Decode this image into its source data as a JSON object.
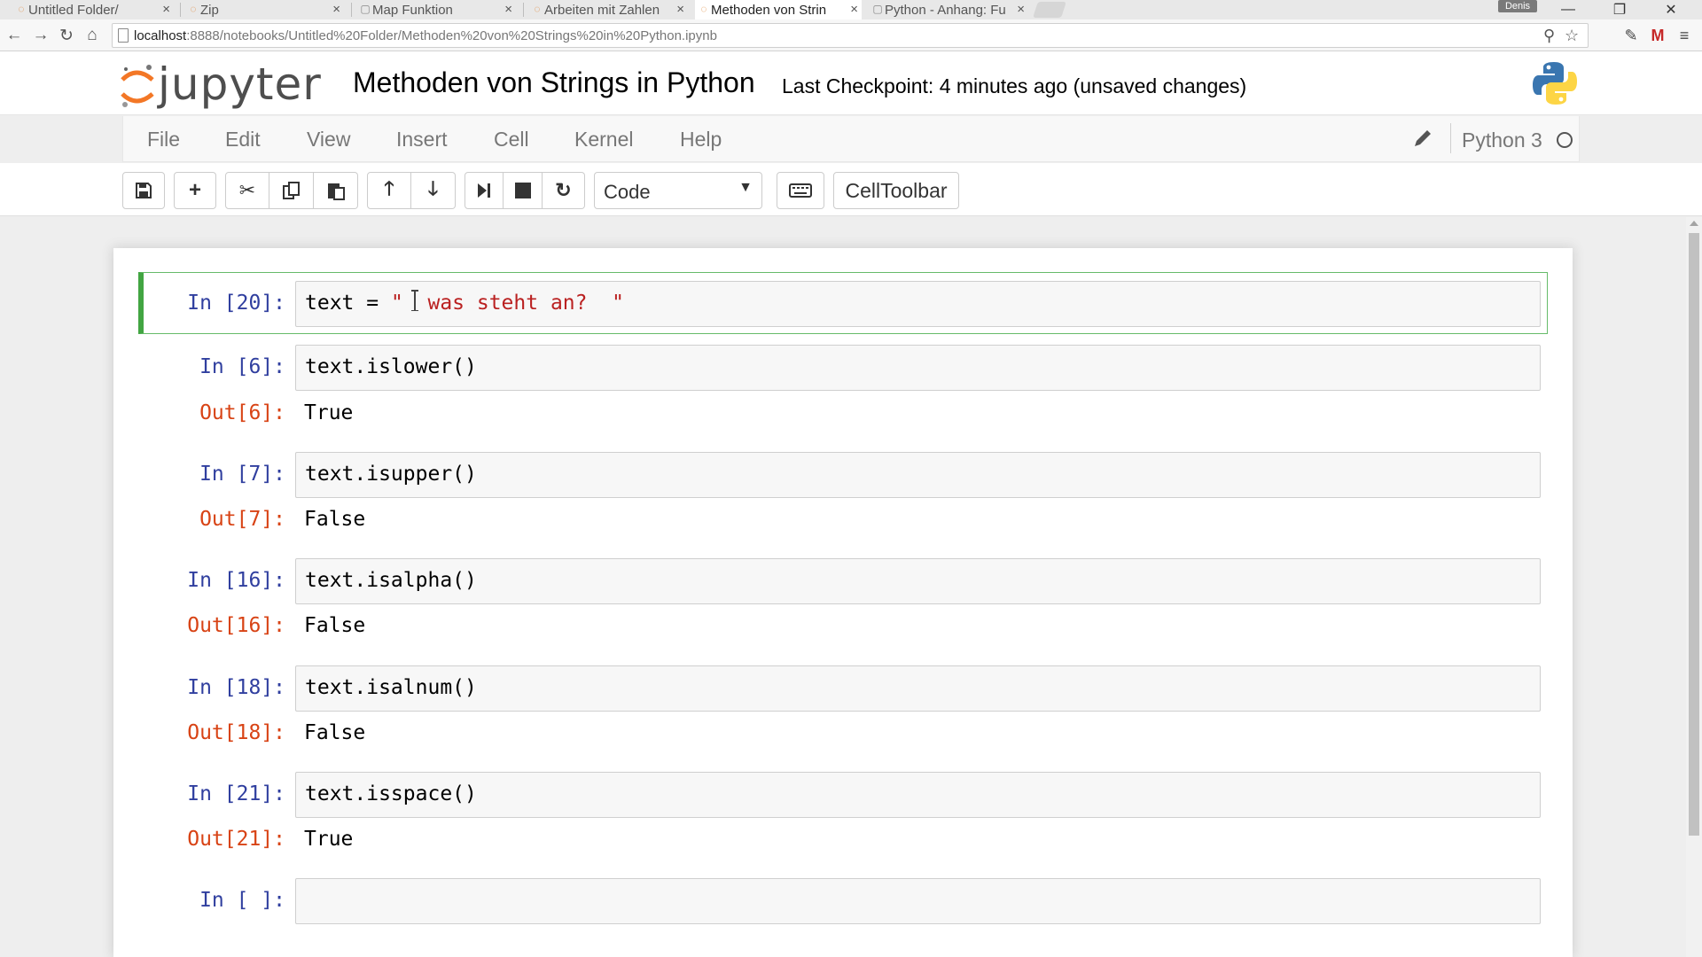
{
  "browser": {
    "tabs": [
      {
        "label": "Untitled Folder/",
        "active": false
      },
      {
        "label": "Zip",
        "active": false
      },
      {
        "label": "Map Funktion",
        "active": false
      },
      {
        "label": "Arbeiten mit Zahlen",
        "active": false
      },
      {
        "label": "Methoden von Strin",
        "active": true
      },
      {
        "label": "Python - Anhang: Fu",
        "active": false
      }
    ],
    "close_glyph": "×",
    "profile_name": "Denis",
    "window_controls": {
      "minimize": "—",
      "restore": "❐",
      "close": "✕"
    },
    "url_host": "localhost",
    "url_path": ":8888/notebooks/Untitled%20Folder/Methoden%20von%20Strings%20in%20Python.ipynb",
    "nav_icons": [
      "back-icon",
      "forward-icon",
      "reload-icon",
      "home-icon"
    ],
    "extension_icons": [
      "zoom-icon",
      "bookmark-star-icon",
      "extension-icon",
      "gmail-icon",
      "chrome-menu-icon"
    ]
  },
  "jupyter": {
    "logo_text": "jupyter",
    "notebook_title": "Methoden von Strings in Python",
    "checkpoint": "Last Checkpoint: 4 minutes ago (unsaved changes)",
    "menu": [
      "File",
      "Edit",
      "View",
      "Insert",
      "Cell",
      "Kernel",
      "Help"
    ],
    "kernel_name": "Python 3",
    "toolbar": {
      "icons": [
        "save-icon",
        "add-cell-icon",
        "cut-icon",
        "copy-icon",
        "paste-icon",
        "move-up-icon",
        "move-down-icon",
        "run-next-icon",
        "stop-icon",
        "restart-icon",
        "keyboard-icon"
      ],
      "cell_type": "Code",
      "celltoolbar_label": "CellToolbar"
    },
    "colors": {
      "prompt_in": "#303f9f",
      "prompt_out": "#d84315",
      "selected_cell": "#42a542",
      "string": "#ba2121"
    }
  },
  "cells": [
    {
      "in_prompt": "In [20]:",
      "code_prefix": "text = ",
      "code_string": "\"  was steht an?  \"",
      "selected": true
    },
    {
      "in_prompt": "In [6]:",
      "code": "text.islower()",
      "out_prompt": "Out[6]:",
      "output": "True"
    },
    {
      "in_prompt": "In [7]:",
      "code": "text.isupper()",
      "out_prompt": "Out[7]:",
      "output": "False"
    },
    {
      "in_prompt": "In [16]:",
      "code": "text.isalpha()",
      "out_prompt": "Out[16]:",
      "output": "False"
    },
    {
      "in_prompt": "In [18]:",
      "code": "text.isalnum()",
      "out_prompt": "Out[18]:",
      "output": "False"
    },
    {
      "in_prompt": "In [21]:",
      "code": "text.isspace()",
      "out_prompt": "Out[21]:",
      "output": "True"
    },
    {
      "in_prompt": "In [ ]:",
      "code": ""
    }
  ]
}
